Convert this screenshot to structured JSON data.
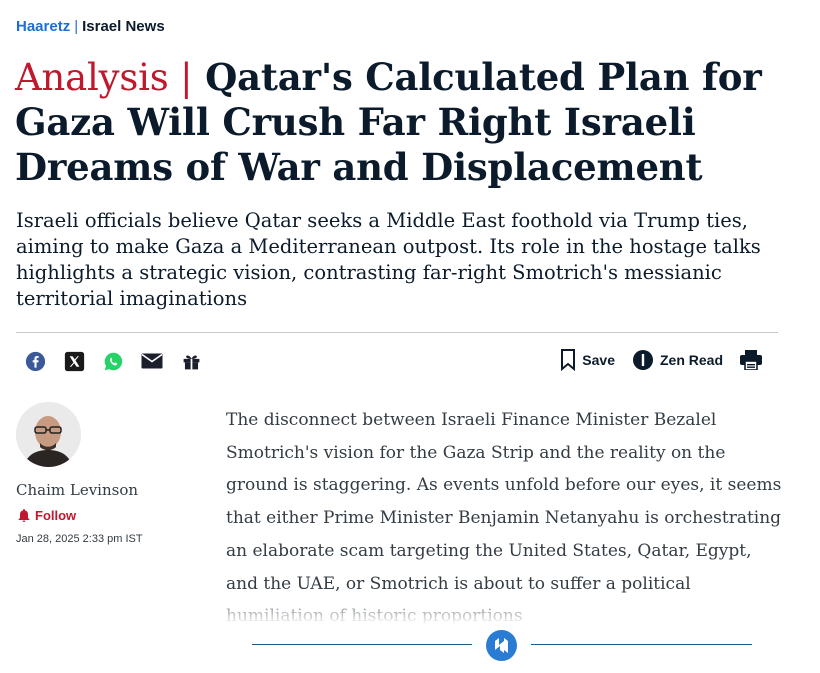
{
  "breadcrumb": {
    "brand": "Haaretz",
    "separator": "|",
    "section": "Israel News"
  },
  "article": {
    "kicker": "Analysis |",
    "title": "Qatar's Calculated Plan for Gaza Will Crush Far Right Israeli Dreams of War and Displacement",
    "dek": "Israeli officials believe Qatar seeks a Middle East foothold via Trump ties, aiming to make Gaza a Mediterranean outpost. Its role in the hostage talks highlights a strategic vision, contrasting far-right Smotrich's messianic territorial imaginations",
    "body": "The disconnect between Israeli Finance Minister Bezalel Smotrich's vision for the Gaza Strip and the reality on the ground is staggering. As events unfold before our eyes, it seems that either Prime Minister Benjamin Netanyahu is orchestrating an elaborate scam targeting the United States, Qatar, Egypt, and the UAE, or Smotrich is about to suffer a political humiliation of historic proportions"
  },
  "share": {
    "icons": [
      "facebook-icon",
      "x-icon",
      "whatsapp-icon",
      "email-icon",
      "gift-icon"
    ]
  },
  "tools": {
    "save_label": "Save",
    "zen_label": "Zen Read"
  },
  "author": {
    "name": "Chaim Levinson",
    "follow_label": "Follow",
    "date": "Jan 28, 2025 2:33 pm IST"
  },
  "colors": {
    "brand_blue": "#1d6fd6",
    "kicker_red": "#c0182d",
    "text_dark": "#0b1b2b",
    "divider_blue": "#1a5d86"
  }
}
